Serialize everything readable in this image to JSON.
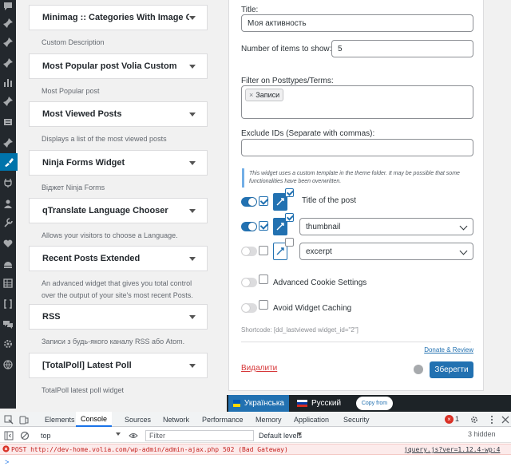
{
  "sidebar": {
    "icons": [
      "comment-icon",
      "pin-icon",
      "pin-icon",
      "pin-icon",
      "stats-icon",
      "pin-icon",
      "media-icon",
      "pin-icon",
      "appearance-icon",
      "plugins-icon",
      "users-icon",
      "tools-icon",
      "heart-icon",
      "dashboard-icon",
      "table-icon",
      "bracket-icon",
      "comments-icon",
      "settings-icon",
      "globe-icon"
    ]
  },
  "available_widgets": [
    {
      "title": "Minimag :: Categories With Image C...",
      "description": "Custom Description"
    },
    {
      "title": "Most Popular post Volia Custom",
      "description": "Most Popular post"
    },
    {
      "title": "Most Viewed Posts",
      "description": "Displays a list of the most viewed posts"
    },
    {
      "title": "Ninja Forms Widget",
      "description": "Віджет Ninja Forms"
    },
    {
      "title": "qTranslate Language Chooser",
      "description": "Allows your visitors to choose a Language."
    },
    {
      "title": "Recent Posts Extended",
      "description": "An advanced widget that gives you total control over the output of your site's most recent Posts."
    },
    {
      "title": "RSS",
      "description": "Записи з будь-якого каналу RSS або Atom."
    },
    {
      "title": "[TotalPoll] Latest Poll",
      "description": "TotalPoll latest poll widget"
    }
  ],
  "widget_form": {
    "title_label": "Title:",
    "title_value": "Моя активность",
    "items_label": "Number of items to show:",
    "items_value": "5",
    "filter_label": "Filter on Posttypes/Terms:",
    "filter_tag_remove": "×",
    "filter_tag": "Записи",
    "exclude_label": "Exclude IDs (Separate with commas):",
    "exclude_value": "",
    "notice": "This widget uses a custom template in the theme folder. It may be possible that some functionalities have been overwritten.",
    "fields": [
      {
        "label": "Title of the post",
        "enabled": true,
        "checked": true
      },
      {
        "select": "thumbnail",
        "enabled": true,
        "checked": true
      },
      {
        "select": "excerpt",
        "enabled": false,
        "checked": false
      }
    ],
    "advanced_cookie_label": "Advanced Cookie Settings",
    "avoid_caching_label": "Avoid Widget Caching",
    "shortcode": "Shortcode: [dd_lastviewed widget_id=\"2\"]",
    "donate_label": "Donate & Review",
    "delete_label": "Видалити",
    "save_label": "Зберегти"
  },
  "language_bar": {
    "languages": [
      {
        "label": "Українська",
        "active": true
      },
      {
        "label": "Русский",
        "active": false
      }
    ],
    "copy_from": "Copy from"
  },
  "devtools": {
    "tabs": [
      "Elements",
      "Console",
      "Sources",
      "Network",
      "Performance",
      "Memory",
      "Application",
      "Security"
    ],
    "active_tab": "Console",
    "error_count": "1",
    "context": "top",
    "filter_placeholder": "Filter",
    "levels": "Default levels",
    "hidden": "3 hidden",
    "log": {
      "method": "POST",
      "url": "http://dev-home.volia.com/wp-admin/admin-ajax.php",
      "status": "502 (Bad Gateway)",
      "source": "jquery.js?ver=1.12.4-wp:4"
    }
  },
  "colors": {
    "accent": "#2271b1",
    "admin_menu": "#23282d",
    "error": "#d63638"
  }
}
